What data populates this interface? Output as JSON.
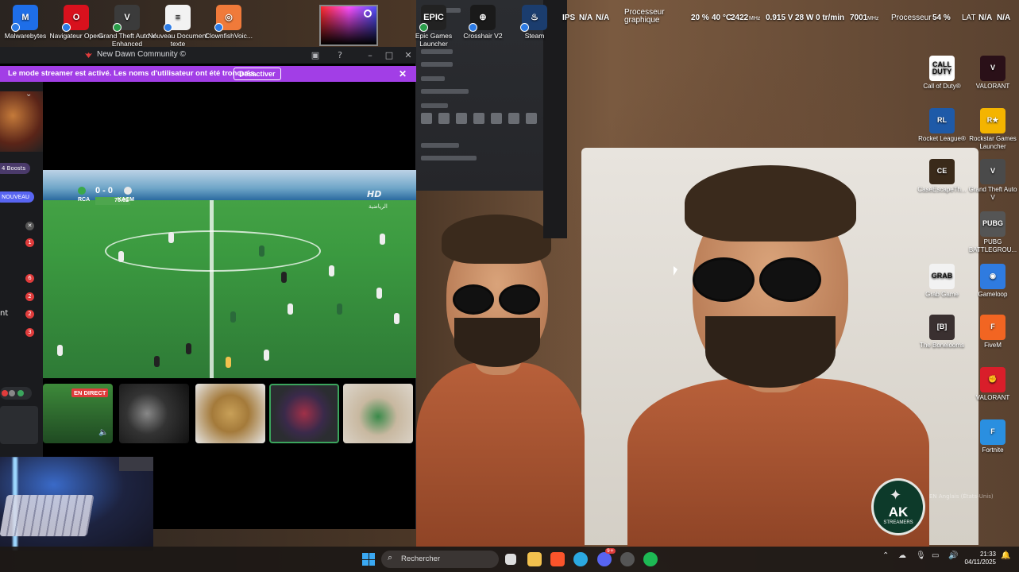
{
  "desktop_top_icons": [
    {
      "label": "Malwarebytes",
      "icon": "malwarebytes-icon",
      "color": "#1e6ee8",
      "glyph": "M"
    },
    {
      "label": "Navigateur Opera",
      "icon": "opera-icon",
      "color": "#d8111d",
      "glyph": "O"
    },
    {
      "label": "Grand Theft Auto V Enhanced",
      "icon": "gta-icon",
      "color": "#3b3b3b",
      "glyph": "V"
    },
    {
      "label": "Nouveau Document texte",
      "icon": "text-document-icon",
      "color": "#f2f2f2",
      "glyph": "≡"
    },
    {
      "label": "ClownfishVoic...",
      "icon": "clownfish-icon",
      "color": "#f07a3a",
      "glyph": "◎"
    },
    {
      "label": "Epic Games Launcher",
      "icon": "epic-games-icon",
      "color": "#222222",
      "glyph": "EPIC"
    },
    {
      "label": "Crosshair V2",
      "icon": "crosshair-icon",
      "color": "#1a1a1a",
      "glyph": "⊕"
    },
    {
      "label": "Steam",
      "icon": "steam-icon",
      "color": "#1b3d6e",
      "glyph": "♨"
    }
  ],
  "osd": {
    "ips_label": "IPS",
    "ips_val1": "N/A",
    "ips_val2": "N/A",
    "gpu_label_1": "Processeur",
    "gpu_label_2": "graphique",
    "gpu_usage": "20 %",
    "gpu_temp": "40 °C",
    "gpu_clock": "2422",
    "gpu_clock_unit": "MHz",
    "gpu_voltage": "0.915 V",
    "gpu_power": "28 W",
    "fan": "0 tr/min",
    "mem_clock": "7001",
    "mem_clock_unit": "MHz",
    "cpu_label": "Processeur",
    "cpu_usage": "54 %",
    "lat_label": "LAT",
    "lat_val1": "N/A",
    "lat_val2": "N/A"
  },
  "discord": {
    "window_title": "New Dawn Community ©",
    "streamer_banner": "Le mode streamer est activé. Les noms d'utilisateur ont été tronqués.",
    "deactivate_button": "Désactiver",
    "rail": {
      "boosts_pill": "4 Boosts",
      "new_pill": "NOUVEAU",
      "badges": [
        "1",
        "6",
        "2",
        "2",
        "3"
      ],
      "nt_text": "nt"
    },
    "stream": {
      "home_team": "RCA",
      "away_team": "KACM",
      "score": "0 - 0",
      "clock": "70:02",
      "channel_logo": "HD",
      "channel_sub": "الرياضية"
    },
    "live_label": "EN DIRECT"
  },
  "desktop_right_icons": [
    {
      "label": "Call of Duty®",
      "icon": "call-of-duty-icon",
      "color": "#ffffff",
      "glyph": "CALL DUTY"
    },
    {
      "label": "VALORANT",
      "icon": "valorant-icon",
      "color": "#2a1018",
      "glyph": "V"
    },
    {
      "label": "Rocket League®",
      "icon": "rocket-league-icon",
      "color": "#1e5aa8",
      "glyph": "RL"
    },
    {
      "label": "Rockstar Games Launcher",
      "icon": "rockstar-icon",
      "color": "#f4b400",
      "glyph": "R★"
    },
    {
      "label": "CaseEscapeTh...",
      "icon": "case-escape-icon",
      "color": "#3a2a1a",
      "glyph": "CE"
    },
    {
      "label": "Grand Theft Auto V",
      "icon": "gta5-icon",
      "color": "#4a4a4a",
      "glyph": "V"
    },
    {
      "label": "PUBG BATTLEGROU...",
      "icon": "pubg-icon",
      "color": "#555555",
      "glyph": "PUBG"
    },
    {
      "label": "Grab Game",
      "icon": "grab-game-icon",
      "color": "#f2f2f2",
      "glyph": "GRAB"
    },
    {
      "label": "Gameloop",
      "icon": "gameloop-icon",
      "color": "#2f7be0",
      "glyph": "◉"
    },
    {
      "label": "The Bonelooms",
      "icon": "bonelooms-icon",
      "color": "#3a3030",
      "glyph": "[B]"
    },
    {
      "label": "FiveM",
      "icon": "fivem-icon",
      "color": "#f26522",
      "glyph": "F"
    },
    {
      "label": "VALORANT",
      "icon": "valorant-riot-icon",
      "color": "#d91e2a",
      "glyph": "✊"
    },
    {
      "label": "Fortnite",
      "icon": "fortnite-icon",
      "color": "#2a8fe0",
      "glyph": "F"
    }
  ],
  "watermark": {
    "big": "AK",
    "small": "STREAMERS"
  },
  "lang_ghost": "EN Anglais (États-Unis)",
  "taskbar": {
    "search_placeholder": "Rechercher",
    "time": "21:33",
    "date": "04/11/2025",
    "discord_badge": "9+"
  }
}
